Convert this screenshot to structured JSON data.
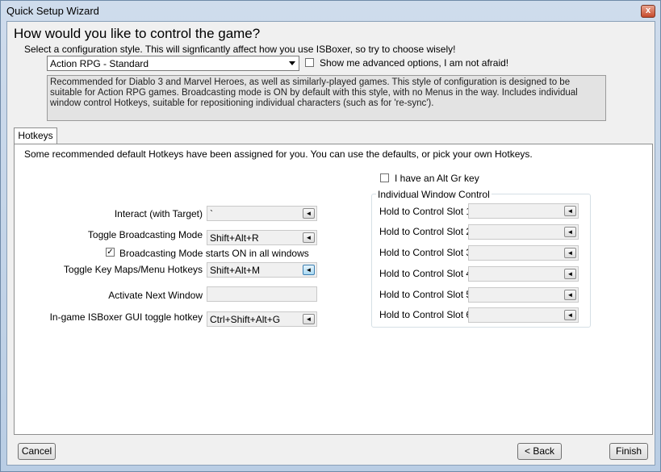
{
  "window": {
    "title": "Quick Setup Wizard",
    "close_glyph": "x"
  },
  "header": {
    "question": "How would you like to control the game?",
    "subtitle": "Select a configuration style. This will signficantly affect how you use ISBoxer, so try to choose wisely!",
    "style_value": "Action RPG - Standard",
    "advanced_label": "Show me advanced options, I am not afraid!",
    "advanced_checked": false,
    "description": "Recommended for Diablo 3 and Marvel Heroes, as well as similarly-played games. This style of configuration is designed to be suitable for Action RPG games. Broadcasting mode is ON by default with this style, with no Menus in the way. Includes individual window control Hotkeys, suitable for repositioning individual characters (such as for 're-sync')."
  },
  "tabs": [
    {
      "label": "Hotkeys",
      "active": true
    }
  ],
  "hotkeys": {
    "hint": "Some recommended default Hotkeys have been assigned for you. You can use the defaults, or pick your own Hotkeys.",
    "pick_glyph": "◄",
    "interact": {
      "label": "Interact (with Target)",
      "value": "`"
    },
    "toggle_broadcasting": {
      "label": "Toggle Broadcasting Mode",
      "value": "Shift+Alt+R"
    },
    "broadcasting_starts_on": {
      "label": "Broadcasting Mode starts ON in all windows",
      "checked": true,
      "check_glyph": "✓"
    },
    "toggle_keymaps": {
      "label": "Toggle Key Maps/Menu Hotkeys",
      "value": "Shift+Alt+M"
    },
    "activate_next": {
      "label": "Activate Next Window",
      "value": ""
    },
    "gui_toggle": {
      "label": "In-game ISBoxer GUI toggle hotkey",
      "value": "Ctrl+Shift+Alt+G"
    },
    "alt_gr": {
      "label": "I have an Alt Gr key",
      "checked": false
    },
    "iwc_title": "Individual Window Control",
    "slots": [
      {
        "label": "Hold to Control Slot 1",
        "value": ""
      },
      {
        "label": "Hold to Control Slot 2",
        "value": ""
      },
      {
        "label": "Hold to Control Slot 3",
        "value": ""
      },
      {
        "label": "Hold to Control Slot 4",
        "value": ""
      },
      {
        "label": "Hold to Control Slot 5",
        "value": ""
      },
      {
        "label": "Hold to Control Slot 6",
        "value": ""
      }
    ]
  },
  "footer": {
    "cancel": "Cancel",
    "back": "< Back",
    "finish": "Finish"
  }
}
